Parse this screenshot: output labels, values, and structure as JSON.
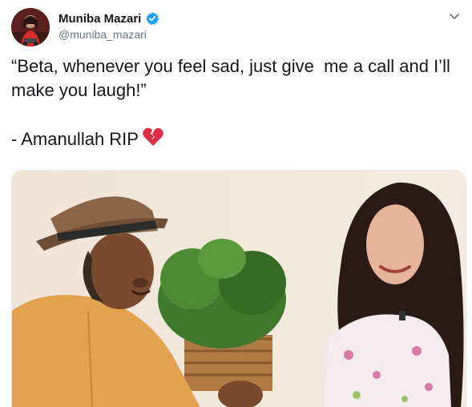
{
  "author": {
    "display_name": "Muniba Mazari",
    "handle": "@muniba_mazari",
    "verified": true,
    "avatar_icon": "avatar-photo"
  },
  "tweet": {
    "text": "“Beta, whenever you feel sad, just give  me a call and I’ll make you laugh!”\n\n- Amanullah RIP",
    "emoji": "broken-heart-icon"
  },
  "menu": {
    "icon": "chevron-down-icon"
  },
  "colors": {
    "text": "#14171a",
    "secondary": "#657786",
    "verified_blue": "#1da1f2",
    "heart_red": "#dd2e44"
  }
}
